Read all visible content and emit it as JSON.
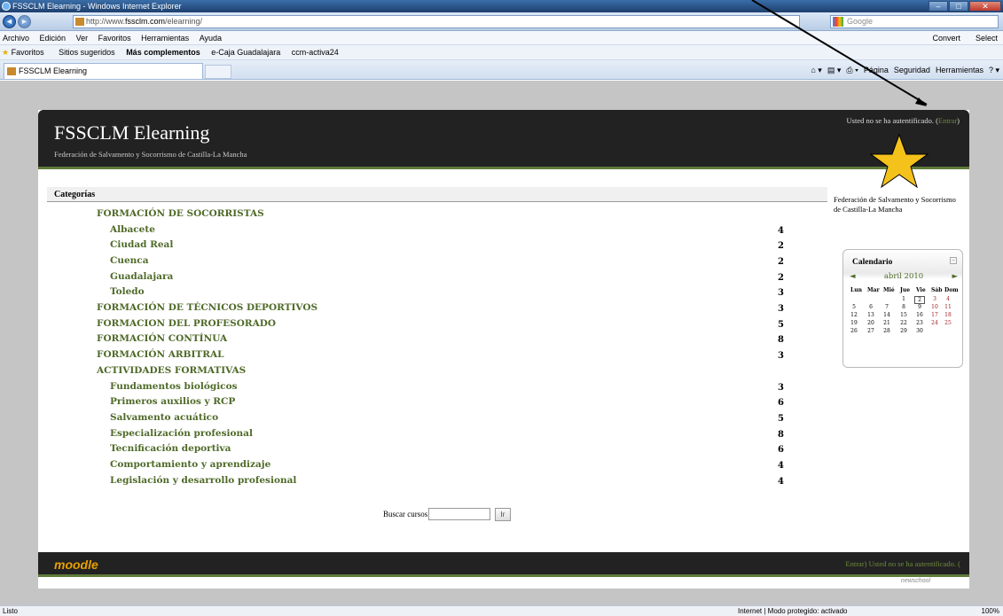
{
  "window": {
    "title": "FSSCLM Elearning - Windows Internet Explorer"
  },
  "address": {
    "url_prefix": "http://www.",
    "url_domain": "fssclm.com",
    "url_path": "/elearning/",
    "search_placeholder": "Google"
  },
  "menu": {
    "items": [
      "Archivo",
      "Edición",
      "Ver",
      "Favoritos",
      "Herramientas",
      "Ayuda"
    ],
    "convert": "Convert",
    "select": "Select"
  },
  "favorites": {
    "label": "Favoritos",
    "items": [
      "Sitios sugeridos",
      "Más complementos",
      "e-Caja Guadalajara",
      "ccm-activa24"
    ]
  },
  "tab": {
    "title": "FSSCLM Elearning"
  },
  "commands": {
    "page": "Página",
    "security": "Seguridad",
    "tools": "Herramientas"
  },
  "site": {
    "title": "FSSCLM Elearning",
    "subtitle": "Federación de Salvamento y Socorrismo de Castilla-La Mancha",
    "login_text": "Usted no se ha autentificado. (",
    "login_link": "Entrar",
    "login_close": ")"
  },
  "categories": {
    "heading": "Categorías",
    "items": [
      {
        "name": "FORMACIÓN DE SOCORRISTAS",
        "count": "",
        "level": 0
      },
      {
        "name": "Albacete",
        "count": "4",
        "level": 1
      },
      {
        "name": "Ciudad Real",
        "count": "2",
        "level": 1
      },
      {
        "name": "Cuenca",
        "count": "2",
        "level": 1
      },
      {
        "name": "Guadalajara",
        "count": "2",
        "level": 1
      },
      {
        "name": "Toledo",
        "count": "3",
        "level": 1
      },
      {
        "name": "FORMACIÓN DE TÉCNICOS DEPORTIVOS",
        "count": "3",
        "level": 0
      },
      {
        "name": "FORMACION DEL PROFESORADO",
        "count": "5",
        "level": 0
      },
      {
        "name": "FORMACIÓN CONTÍNUA",
        "count": "8",
        "level": 0
      },
      {
        "name": "FORMACIÓN ARBITRAL",
        "count": "3",
        "level": 0
      },
      {
        "name": "ACTIVIDADES FORMATIVAS",
        "count": "",
        "level": 0
      },
      {
        "name": "Fundamentos biológicos",
        "count": "3",
        "level": 1
      },
      {
        "name": "Primeros auxilios y RCP",
        "count": "6",
        "level": 1
      },
      {
        "name": "Salvamento acuático",
        "count": "5",
        "level": 1
      },
      {
        "name": "Especialización profesional",
        "count": "8",
        "level": 1
      },
      {
        "name": "Tecnificación deportiva",
        "count": "6",
        "level": 1
      },
      {
        "name": "Comportamiento y aprendizaje",
        "count": "4",
        "level": 1
      },
      {
        "name": "Legislación y desarrollo profesional",
        "count": "4",
        "level": 1
      }
    ]
  },
  "search": {
    "label": "Buscar cursos:",
    "button": "Ir"
  },
  "sidebar": {
    "info": "Federación de Salvamento y Socorrismo de Castilla-La Mancha"
  },
  "calendar": {
    "title": "Calendario",
    "month": "abril 2010",
    "prev": "◄",
    "next": "►",
    "days": [
      "Lun",
      "Mar",
      "Mié",
      "Jue",
      "Vie",
      "Sáb",
      "Dom"
    ],
    "weeks": [
      [
        "",
        "",
        "",
        "1",
        "2",
        "3",
        "4"
      ],
      [
        "5",
        "6",
        "7",
        "8",
        "9",
        "10",
        "11"
      ],
      [
        "12",
        "13",
        "14",
        "15",
        "16",
        "17",
        "18"
      ],
      [
        "19",
        "20",
        "21",
        "22",
        "23",
        "24",
        "25"
      ],
      [
        "26",
        "27",
        "28",
        "29",
        "30",
        "",
        ""
      ]
    ],
    "today": "2"
  },
  "footer": {
    "logo": "moodle",
    "login": "Entrar)   Usted no se ha autentificado. (",
    "credit": "newschool"
  },
  "status": {
    "left": "Listo",
    "middle": "Internet | Modo protegido: activado",
    "zoom": "100%"
  },
  "colors": {
    "link": "#4f6a28",
    "header": "#222222",
    "star": "#f5c21b"
  }
}
